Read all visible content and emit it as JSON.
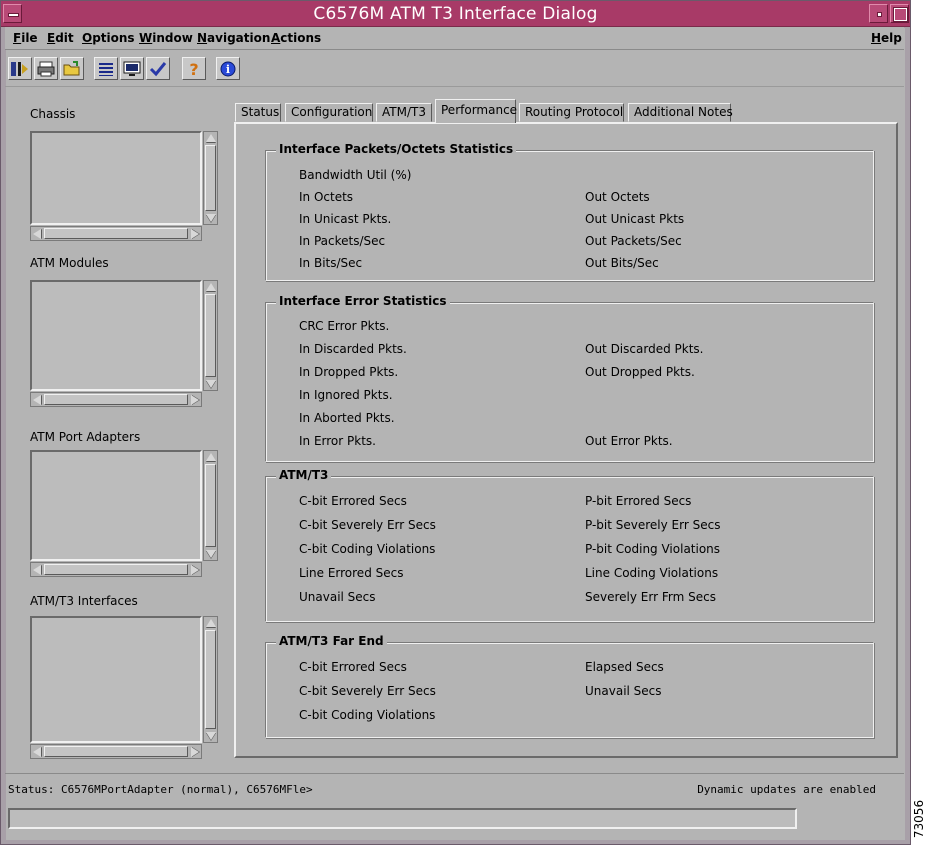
{
  "window": {
    "title": "C6576M ATM T3 Interface Dialog"
  },
  "menu": {
    "items": [
      "File",
      "Edit",
      "Options",
      "Window",
      "Navigation",
      "Actions"
    ],
    "help": "Help"
  },
  "toolbar": {
    "icons": [
      "device-icon",
      "printer-icon",
      "open-folder-icon",
      "list-icon",
      "monitor-icon",
      "checkmark-icon",
      "help-icon",
      "info-icon"
    ]
  },
  "sidebar": {
    "lists": [
      {
        "label": "Chassis"
      },
      {
        "label": "ATM Modules"
      },
      {
        "label": "ATM Port Adapters"
      },
      {
        "label": "ATM/T3 Interfaces"
      }
    ]
  },
  "tabs": [
    "Status",
    "Configuration",
    "ATM/T3",
    "Performance",
    "Routing Protocol",
    "Additional Notes"
  ],
  "active_tab": "Performance",
  "groups": [
    {
      "title": "Interface Packets/Octets Statistics",
      "rows": [
        [
          "Bandwidth Util (%)",
          ""
        ],
        [
          "In Octets",
          "Out Octets"
        ],
        [
          "In Unicast Pkts.",
          "Out Unicast Pkts"
        ],
        [
          "In Packets/Sec",
          "Out Packets/Sec"
        ],
        [
          "In Bits/Sec",
          "Out Bits/Sec"
        ]
      ]
    },
    {
      "title": "Interface Error Statistics",
      "rows": [
        [
          "CRC Error Pkts.",
          ""
        ],
        [
          "In Discarded Pkts.",
          "Out Discarded Pkts."
        ],
        [
          "In Dropped Pkts.",
          "Out Dropped Pkts."
        ],
        [
          "In Ignored Pkts.",
          ""
        ],
        [
          "In Aborted Pkts.",
          ""
        ],
        [
          "In Error Pkts.",
          "Out Error Pkts."
        ]
      ]
    },
    {
      "title": "ATM/T3",
      "rows": [
        [
          "C-bit Errored Secs",
          "P-bit Errored Secs"
        ],
        [
          "C-bit Severely Err Secs",
          "P-bit Severely Err Secs"
        ],
        [
          "C-bit Coding Violations",
          "P-bit Coding Violations"
        ],
        [
          "Line Errored Secs",
          "Line Coding Violations"
        ],
        [
          "Unavail Secs",
          "Severely Err Frm Secs"
        ]
      ]
    },
    {
      "title": "ATM/T3 Far End",
      "rows": [
        [
          "C-bit Errored Secs",
          "Elapsed Secs"
        ],
        [
          "C-bit Severely Err Secs",
          "Unavail Secs"
        ],
        [
          "C-bit Coding Violations",
          ""
        ]
      ]
    }
  ],
  "status": {
    "text": "Status: C6576MPortAdapter (normal), C6576MFle>",
    "updates": "Dynamic updates are enabled"
  },
  "figure_id": "73056"
}
